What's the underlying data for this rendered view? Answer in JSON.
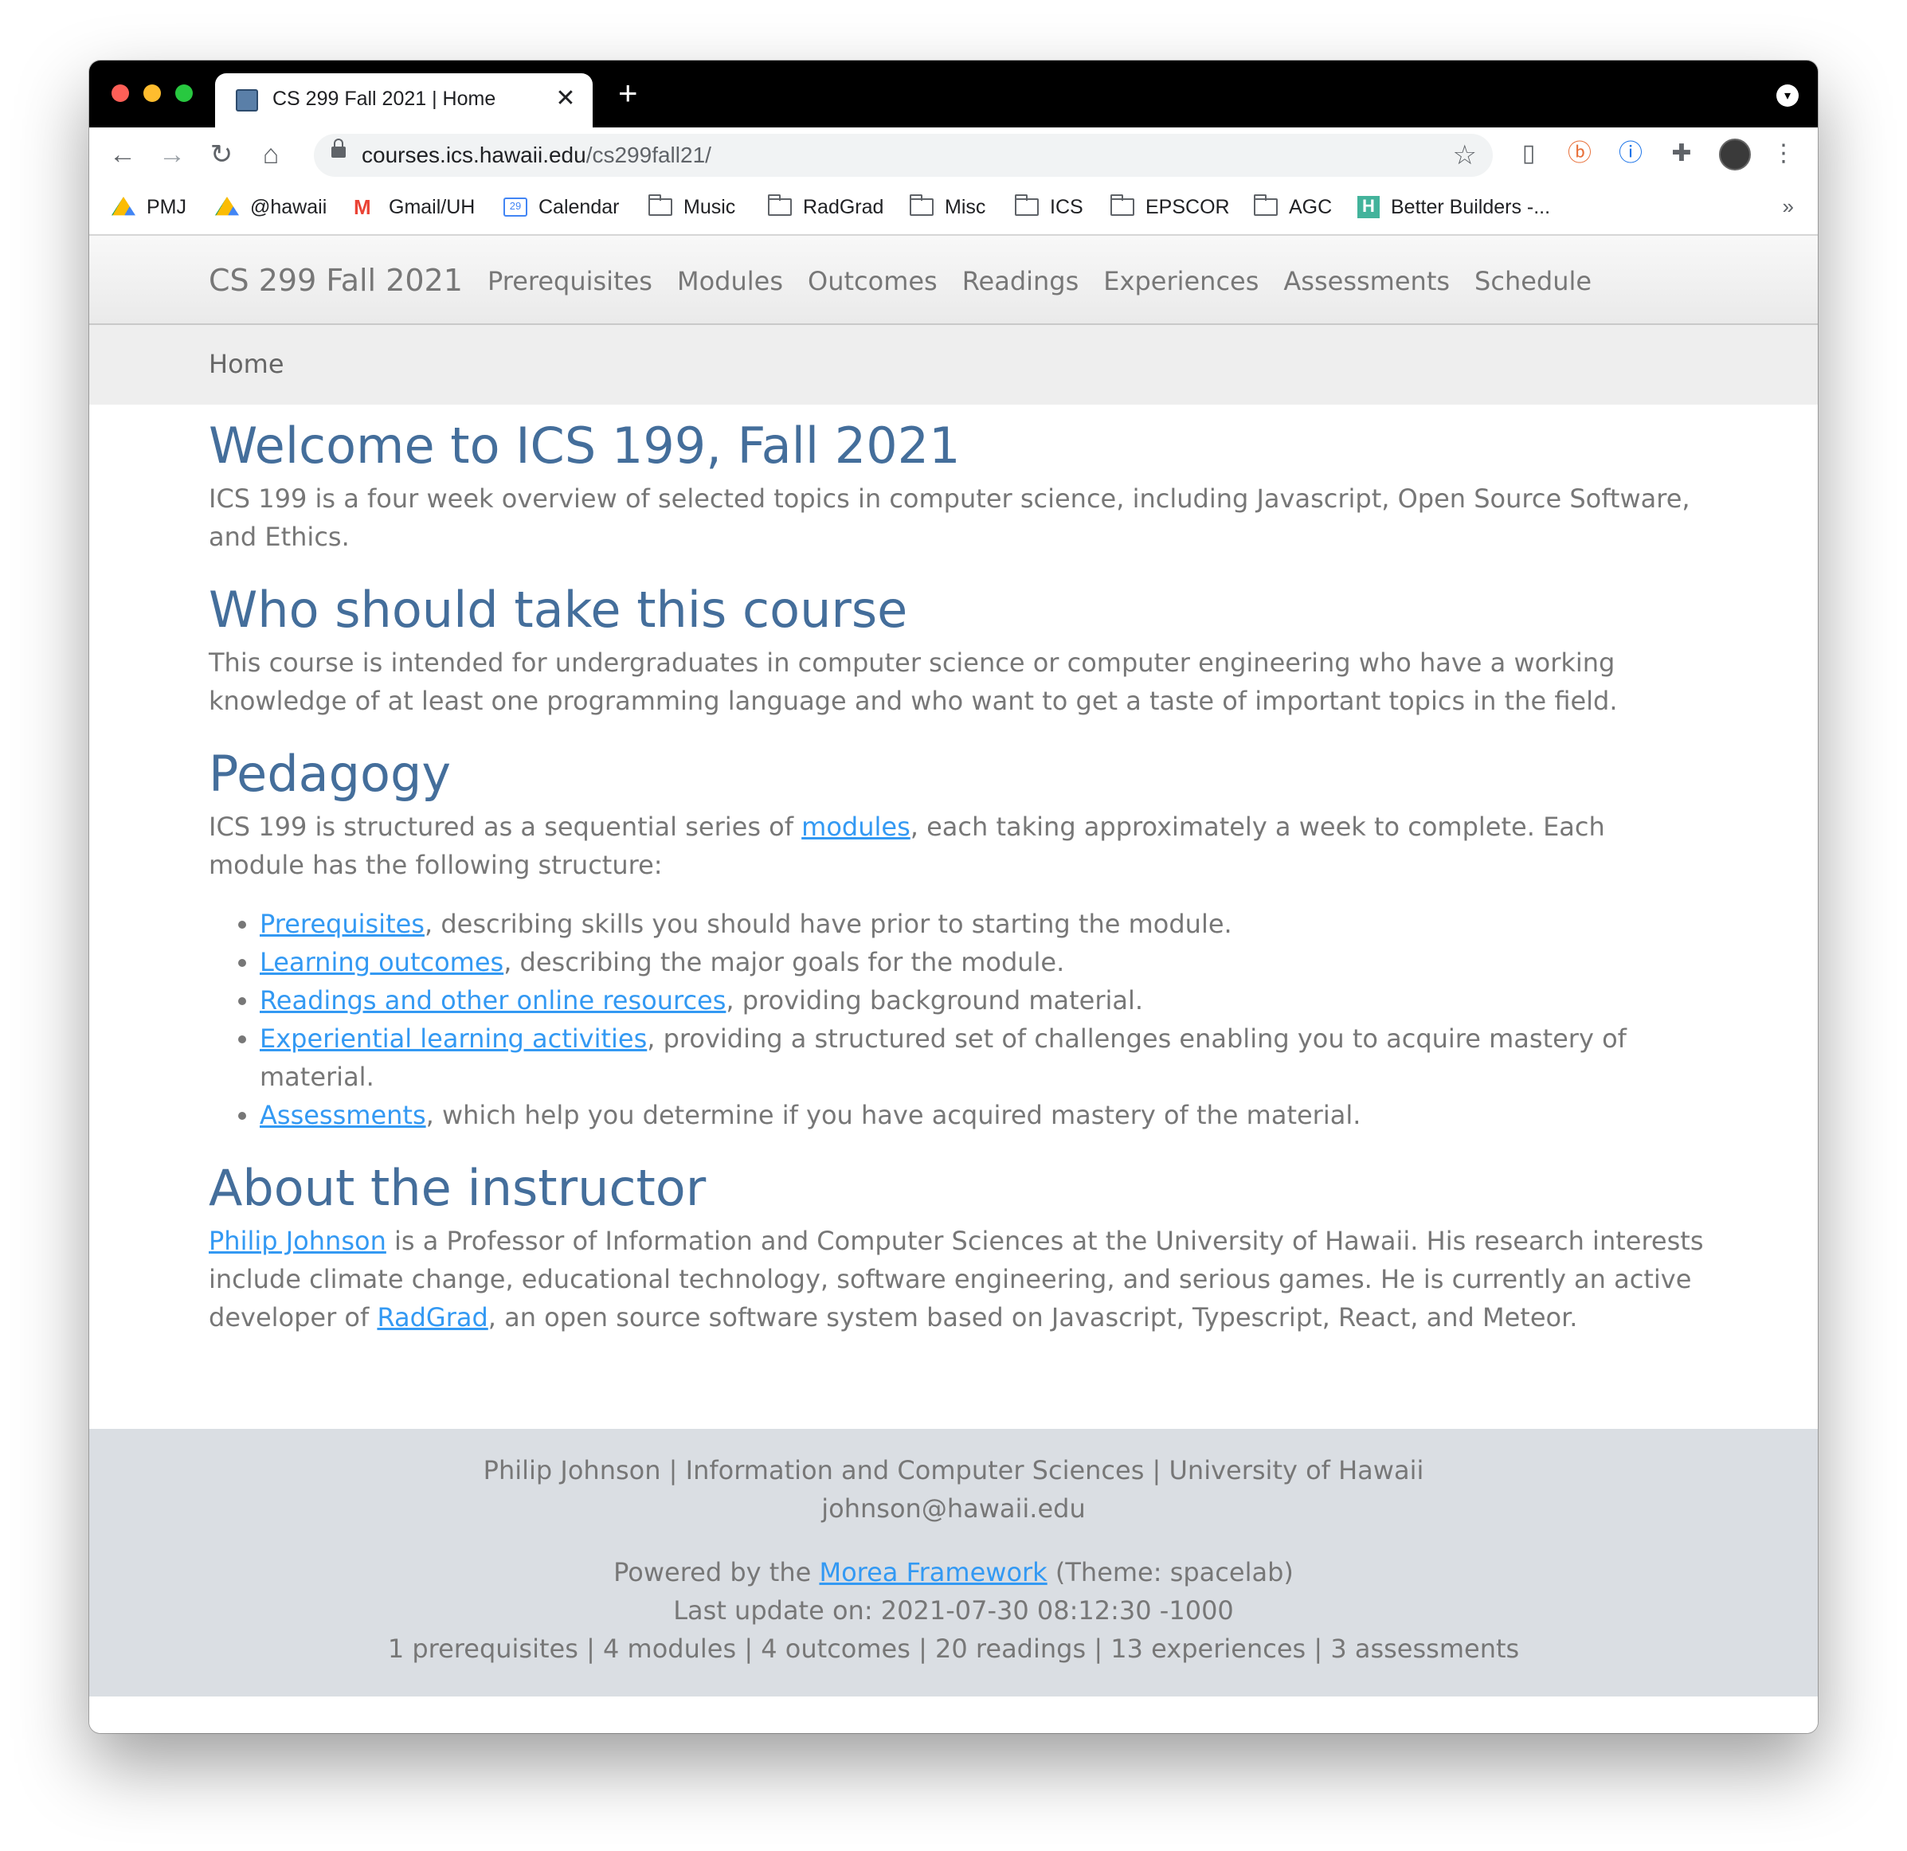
{
  "browser": {
    "tab_title": "CS 299 Fall 2021 | Home",
    "url_host": "courses.ics.hawaii.edu",
    "url_path": "/cs299fall21/",
    "bookmarks": [
      {
        "label": "PMJ",
        "icon": "google-drive-icon"
      },
      {
        "label": "@hawaii",
        "icon": "google-drive-icon"
      },
      {
        "label": "Gmail/UH",
        "icon": "gmail-icon"
      },
      {
        "label": "Calendar",
        "icon": "calendar-icon"
      },
      {
        "label": "Music",
        "icon": "folder-icon"
      },
      {
        "label": "RadGrad",
        "icon": "folder-icon"
      },
      {
        "label": "Misc",
        "icon": "folder-icon"
      },
      {
        "label": "ICS",
        "icon": "folder-icon"
      },
      {
        "label": "EPSCOR",
        "icon": "folder-icon"
      },
      {
        "label": "AGC",
        "icon": "folder-icon"
      },
      {
        "label": "Better Builders -...",
        "icon": "h-icon"
      }
    ],
    "more_bookmarks": "»"
  },
  "site": {
    "brand": "CS 299 Fall 2021",
    "nav": [
      "Prerequisites",
      "Modules",
      "Outcomes",
      "Readings",
      "Experiences",
      "Assessments",
      "Schedule"
    ],
    "breadcrumb": "Home"
  },
  "content": {
    "welcome_title": "Welcome to ICS 199, Fall 2021",
    "welcome_text": "ICS 199 is a four week overview of selected topics in computer science, including Javascript, Open Source Software, and Ethics.",
    "who_title": "Who should take this course",
    "who_text": "This course is intended for undergraduates in computer science or computer engineering who have a working knowledge of at least one programming language and who want to get a taste of important topics in the field.",
    "pedagogy_title": "Pedagogy",
    "pedagogy_pre": "ICS 199 is structured as a sequential series of ",
    "pedagogy_link": "modules",
    "pedagogy_post": ", each taking approximately a week to complete. Each module has the following structure:",
    "structure": [
      {
        "link": "Prerequisites",
        "text": ", describing skills you should have prior to starting the module."
      },
      {
        "link": "Learning outcomes",
        "text": ", describing the major goals for the module."
      },
      {
        "link": "Readings and other online resources",
        "text": ", providing background material."
      },
      {
        "link": "Experiential learning activities",
        "text": ", providing a structured set of challenges enabling you to acquire mastery of material."
      },
      {
        "link": "Assessments",
        "text": ", which help you determine if you have acquired mastery of the material."
      }
    ],
    "instructor_title": "About the instructor",
    "instructor_link": "Philip Johnson",
    "instructor_text": " is a Professor of Information and Computer Sciences at the University of Hawaii. His research interests include climate change, educational technology, software engineering, and serious games. He is currently an active developer of ",
    "radgrad_link": "RadGrad",
    "instructor_post": ", an open source software system based on Javascript, Typescript, React, and Meteor."
  },
  "footer": {
    "line1": "Philip Johnson | Information and Computer Sciences | University of Hawaii",
    "email": "johnson@hawaii.edu",
    "powered_pre": "Powered by the ",
    "powered_link": "Morea Framework",
    "powered_post": " (Theme: spacelab)",
    "last_update": "Last update on: 2021-07-30 08:12:30 -1000",
    "stats": "1 prerequisites | 4 modules | 4 outcomes | 20 readings | 13 experiences | 3 assessments"
  }
}
